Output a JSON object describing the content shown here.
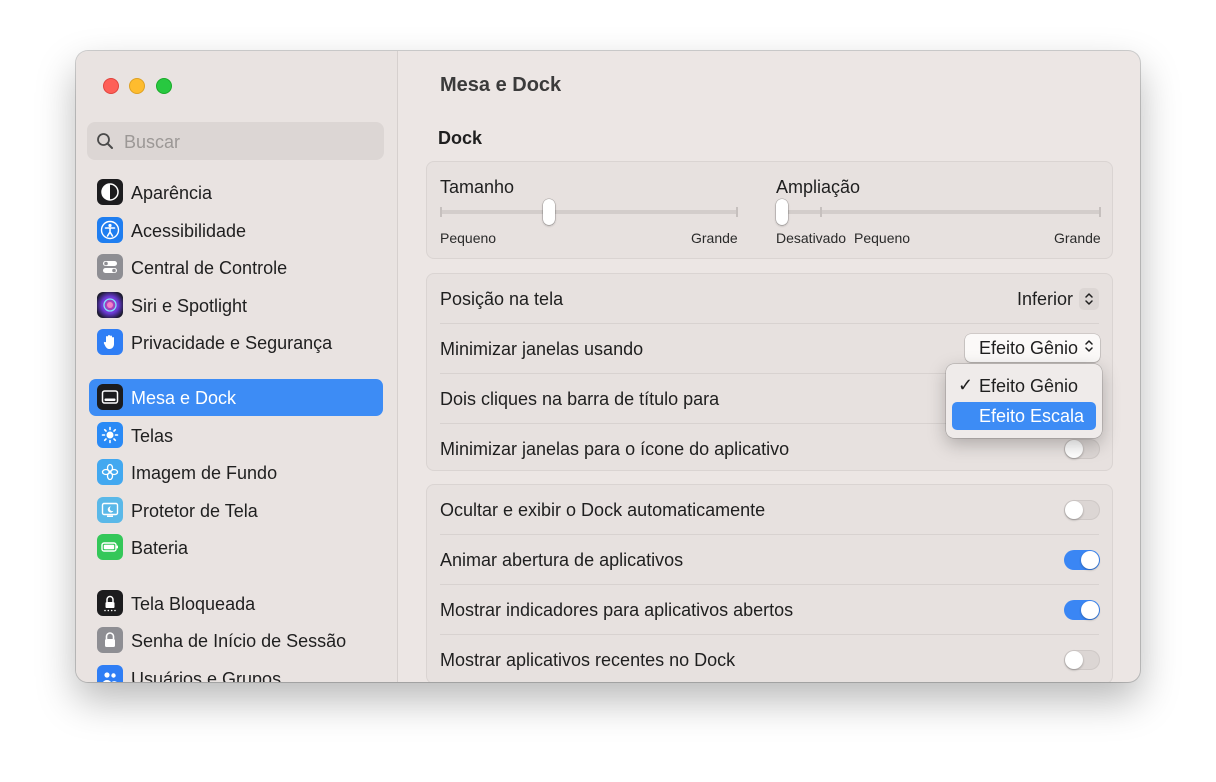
{
  "sidebar": {
    "search_placeholder": "Buscar",
    "items": [
      {
        "label": "Aparência",
        "icon": "appearance-icon",
        "color": "#1c1c1e"
      },
      {
        "label": "Acessibilidade",
        "icon": "accessibility-icon",
        "color": "#1f7ef0"
      },
      {
        "label": "Central de Controle",
        "icon": "control-center-icon",
        "color": "#8e8e93"
      },
      {
        "label": "Siri e Spotlight",
        "icon": "siri-icon",
        "color": "#3a2a5c"
      },
      {
        "label": "Privacidade e Segurança",
        "icon": "hand-icon",
        "color": "#2f7ef5"
      },
      {
        "label": "Mesa e Dock",
        "icon": "dock-icon",
        "color": "#1c1c1e",
        "selected": true
      },
      {
        "label": "Telas",
        "icon": "sun-icon",
        "color": "#2a8af6"
      },
      {
        "label": "Imagem de Fundo",
        "icon": "flower-icon",
        "color": "#42a8f0"
      },
      {
        "label": "Protetor de Tela",
        "icon": "screensaver-icon",
        "color": "#5ab8e8"
      },
      {
        "label": "Bateria",
        "icon": "battery-icon",
        "color": "#34c759"
      },
      {
        "label": "Tela Bloqueada",
        "icon": "lock-screen-icon",
        "color": "#1c1c1e"
      },
      {
        "label": "Senha de Início de Sessão",
        "icon": "lock-icon",
        "color": "#8e8e93"
      },
      {
        "label": "Usuários e Grupos",
        "icon": "users-icon",
        "color": "#2f7ef5"
      }
    ]
  },
  "main": {
    "title": "Mesa e Dock",
    "section": "Dock",
    "size_slider": {
      "label": "Tamanho",
      "min_label": "Pequeno",
      "max_label": "Grande",
      "value_fraction": 0.36
    },
    "magnification_slider": {
      "label": "Ampliação",
      "off_label": "Desativado",
      "min_label": "Pequeno",
      "max_label": "Grande",
      "value_fraction": 0.0
    },
    "rows_group1": [
      {
        "label": "Posição na tela",
        "control": "popup",
        "value": "Inferior"
      },
      {
        "label": "Minimizar janelas usando",
        "control": "popup-button",
        "value": "Efeito Gênio"
      },
      {
        "label": "Dois cliques na barra de título para",
        "control": "popup"
      },
      {
        "label": "Minimizar janelas para o ícone do aplicativo",
        "control": "toggle",
        "on": false
      }
    ],
    "rows_group2": [
      {
        "label": "Ocultar e exibir o Dock automaticamente",
        "on": false
      },
      {
        "label": "Animar abertura de aplicativos",
        "on": true
      },
      {
        "label": "Mostrar indicadores para aplicativos abertos",
        "on": true
      },
      {
        "label": "Mostrar aplicativos recentes no Dock",
        "on": false
      }
    ]
  },
  "menu": {
    "check": "✓",
    "items": [
      "Efeito Gênio",
      "Efeito Escala"
    ],
    "checked": "Efeito Gênio",
    "highlighted": "Efeito Escala"
  },
  "colors": {
    "accent": "#3d8cf5",
    "toggle_on": "#3a86f4"
  }
}
